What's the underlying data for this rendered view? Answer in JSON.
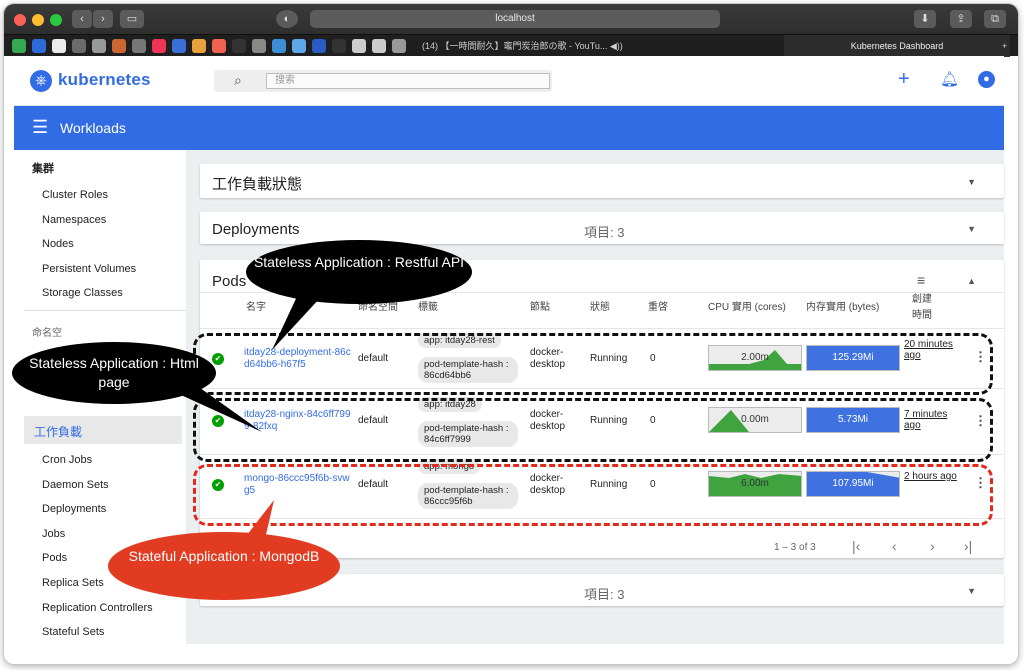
{
  "browser": {
    "url": "localhost",
    "tabs": [
      {
        "label": "(14) 【一時間耐久】竈門炭治郎の歌 - YouTu... ◀))"
      },
      {
        "label": "Kubernetes Dashboard"
      }
    ]
  },
  "header": {
    "brand": "kubernetes",
    "search_placeholder": "搜索",
    "icons": [
      "plus-icon",
      "bell-icon",
      "account-icon"
    ]
  },
  "toolbar": {
    "title": "Workloads"
  },
  "sidebar": {
    "section": "集群",
    "cluster_items": [
      "Cluster Roles",
      "Namespaces",
      "Nodes",
      "Persistent Volumes",
      "Storage Classes"
    ],
    "namespace_label": "命名空",
    "active": "工作負載",
    "workload_items": [
      "Cron Jobs",
      "Daemon Sets",
      "Deployments",
      "Jobs",
      "Pods",
      "Replica Sets",
      "Replication Controllers",
      "Stateful Sets"
    ]
  },
  "cards": {
    "status": {
      "title": "工作負載狀態"
    },
    "deployments": {
      "title": "Deployments",
      "count": "項目: 3"
    },
    "pods": {
      "title": "Pods"
    },
    "bottom": {
      "count": "項目: 3"
    }
  },
  "pods_table": {
    "columns": [
      "名字",
      "命名空間",
      "標籤",
      "節點",
      "狀態",
      "重啓",
      "CPU 實用 (cores)",
      "内存實用 (bytes)",
      "創建",
      "時間"
    ],
    "rows": [
      {
        "name": "itday28-deployment-86cd64bb6-h67f5",
        "namespace": "default",
        "labels": [
          "app: itday28-rest",
          "pod-template-hash : 86cd64bb6"
        ],
        "node": "docker-desktop",
        "status": "Running",
        "restarts": "0",
        "cpu": "2.00m",
        "memory": "125.29Mi",
        "age": "20 minutes ago"
      },
      {
        "name": "itday28-nginx-84c6ff7999-82fxq",
        "namespace": "default",
        "labels": [
          "app: itday28",
          "pod-template-hash : 84c6ff7999"
        ],
        "node": "docker-desktop",
        "status": "Running",
        "restarts": "0",
        "cpu": "0.00m",
        "memory": "5.73Mi",
        "age": "7 minutes ago"
      },
      {
        "name": "mongo-86ccc95f6b-svwg5",
        "namespace": "default",
        "labels": [
          "app: mongo",
          "pod-template-hash : 86ccc95f6b"
        ],
        "node": "docker-desktop",
        "status": "Running",
        "restarts": "0",
        "cpu": "6.00m",
        "memory": "107.95Mi",
        "age": "2 hours ago"
      }
    ],
    "pagination": "1 – 3 of 3"
  },
  "annotations": {
    "restful": "Stateless Application : Restful API",
    "html": "Stateless Application : Html page",
    "mongo": "Stateful  Application : MongodB"
  },
  "colors": {
    "brand": "#326ce5",
    "cpu": "#3fa33f",
    "memory": "#3f72e0",
    "highlight_black": "#111111",
    "highlight_red": "#e02a1b"
  }
}
